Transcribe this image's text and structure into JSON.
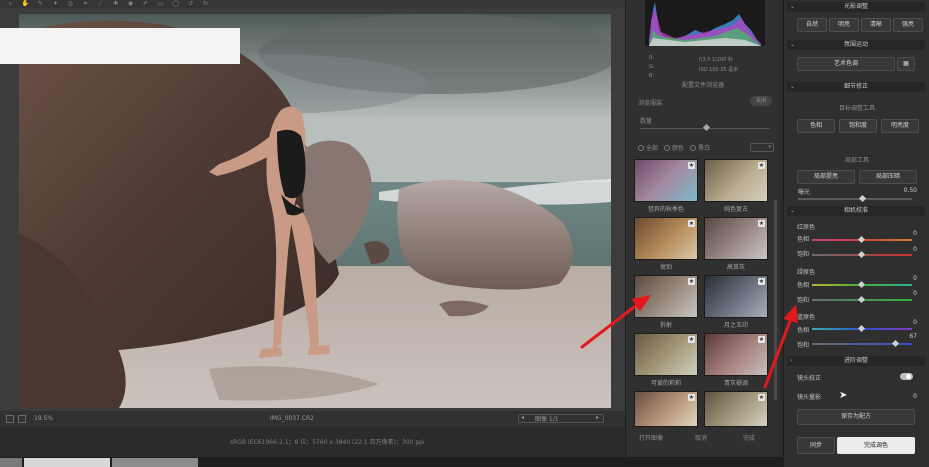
{
  "toolbar": {
    "tools": [
      "zoom-icon",
      "hand-icon",
      "eyedropper-icon",
      "color-sampler-icon",
      "target-adjust-icon",
      "crop-icon",
      "straighten-icon",
      "spot-removal-icon",
      "redeye-icon",
      "brush-icon",
      "gradient-icon",
      "radial-icon",
      "rotate-left-icon",
      "rotate-right-icon"
    ]
  },
  "canvas": {
    "zoom": "19.5%",
    "filename": "IMG_0037.CR2"
  },
  "pager": {
    "text": "图像 1/1"
  },
  "image_info": "sRGB IEC61966-2.1；8 位；5760 x 3840 (22.1 百万像素)；300 ppi",
  "middle": {
    "readout": {
      "r": "R:",
      "g": "G:",
      "b": "B:",
      "camera": "f/3.5  1/200 秒",
      "iso": "ISO 100  35 毫米"
    },
    "profile_title": "配置文件浏览器",
    "browse_label": "浏览服装",
    "close": "关闭",
    "amount_label": "数量",
    "filters": [
      "全部",
      "颜色",
      "黑白"
    ],
    "presets": [
      {
        "label": "怪异的秋季色"
      },
      {
        "label": "纯色复古"
      },
      {
        "label": "琥珀"
      },
      {
        "label": "高草灰"
      },
      {
        "label": "折射"
      },
      {
        "label": "月之玉印"
      },
      {
        "label": "可爱的莉莉"
      },
      {
        "label": "青灰褪调"
      }
    ],
    "bottom": {
      "open": "打开图像",
      "cancel": "取消",
      "done": "完成"
    }
  },
  "right": {
    "presence_title": "光影调整",
    "presence_buttons": [
      "自然",
      "明亮",
      "清晰",
      "强亮"
    ],
    "art_title": "氛围运动",
    "art_button": "艺术色调",
    "detail_title": "细节修正",
    "target_label": "目标调整工具",
    "target_buttons": [
      "色相",
      "饱和度",
      "明亮度"
    ],
    "local_label": "局部工具",
    "local_buttons": [
      "局部提亮",
      "局部压暗"
    ],
    "exposure": {
      "label": "曝光",
      "value": "0.50"
    },
    "calib_title": "相机校准",
    "red": {
      "label": "红原色",
      "hue_label": "色相",
      "hue_value": "0",
      "sat_label": "饱和",
      "sat_value": "0"
    },
    "green": {
      "label": "绿原色",
      "hue_label": "色相",
      "hue_value": "0",
      "sat_label": "饱和",
      "sat_value": "0"
    },
    "blue": {
      "label": "蓝原色",
      "hue_label": "色相",
      "hue_value": "0",
      "sat_label": "饱和",
      "sat_value": "67"
    },
    "advanced_title": "进阶调整",
    "lens_label": "镜头校正",
    "lens_amount_label": "镜头量影",
    "lens_amount_value": "0",
    "save_preset": "保存为配方",
    "sync": "同步",
    "finish": "完成调色"
  }
}
